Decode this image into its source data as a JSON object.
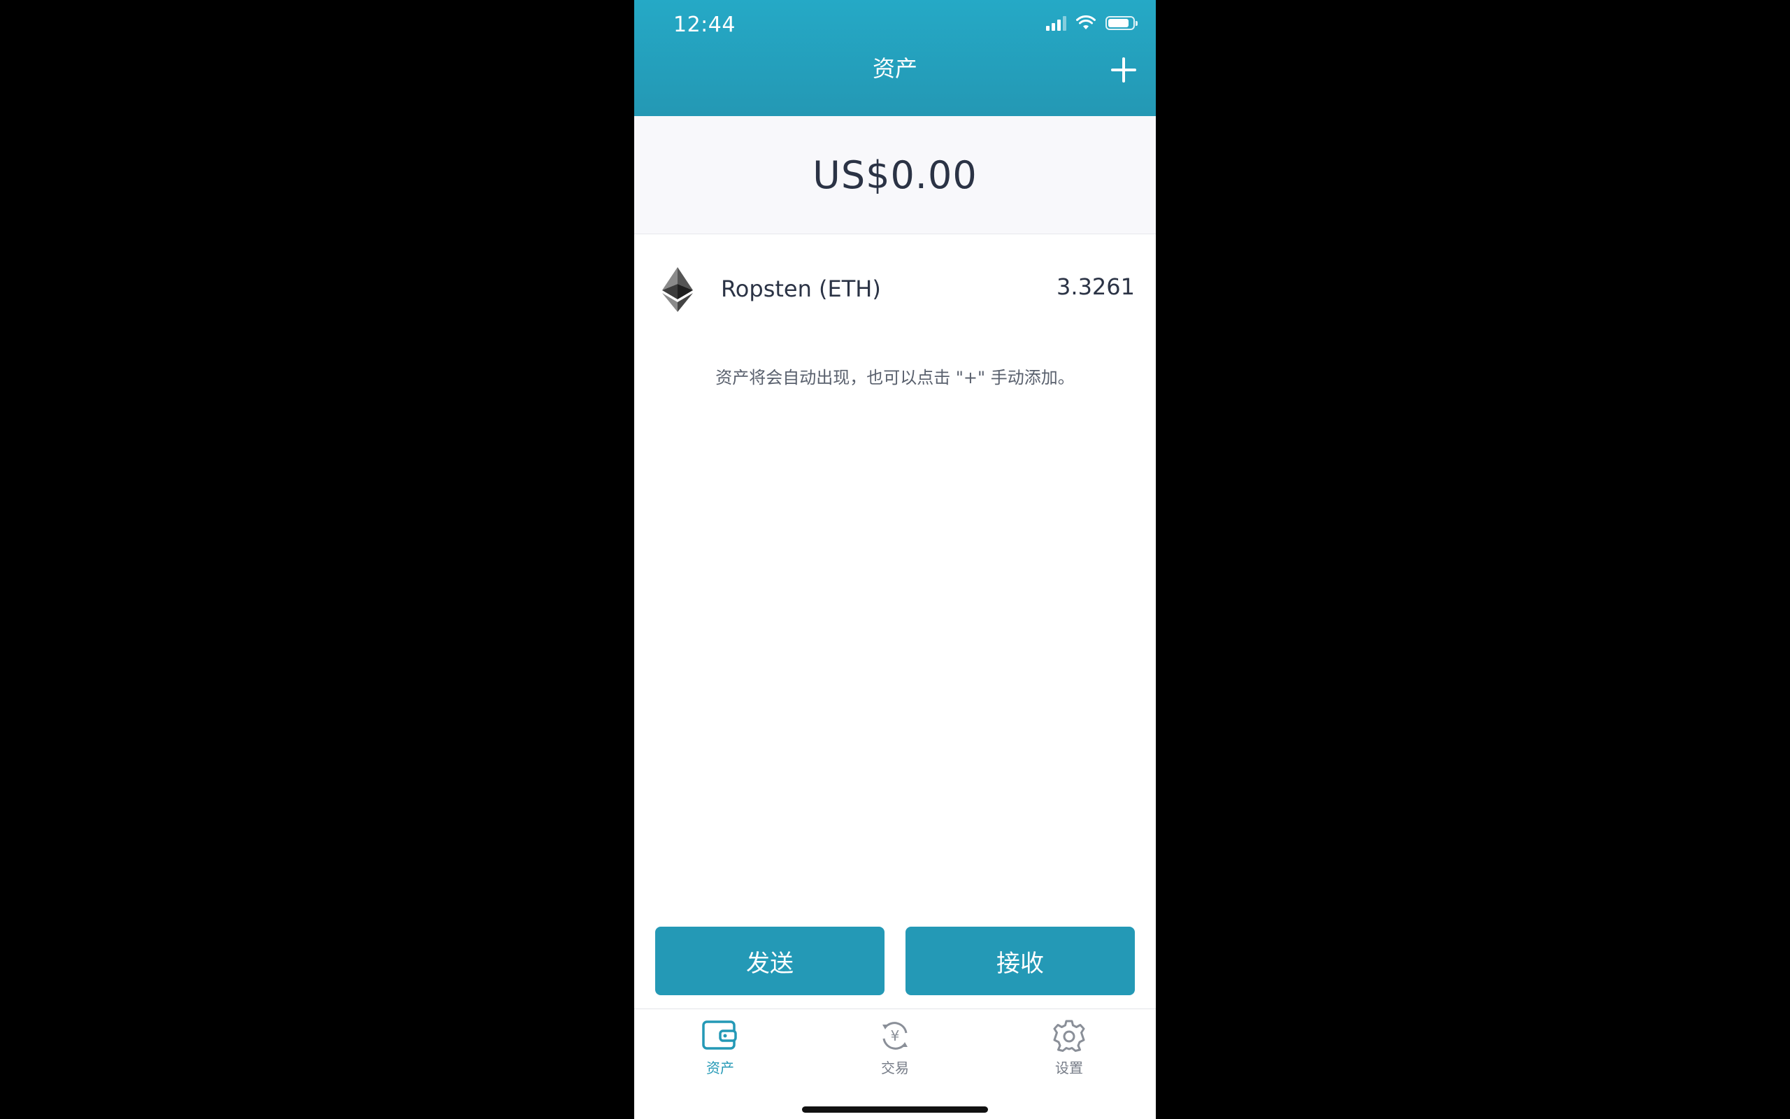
{
  "status_bar": {
    "time": "12:44",
    "signal_icon": "signal-icon",
    "wifi_icon": "wifi-icon",
    "battery_icon": "battery-icon",
    "battery_level": 0.85
  },
  "header": {
    "title": "资产",
    "add_icon": "plus-icon",
    "background_color": "#25a9c6"
  },
  "balance": {
    "total": "US$0.00"
  },
  "assets": [
    {
      "icon": "ethereum-icon",
      "name": "Ropsten (ETH)",
      "amount": "3.3261"
    }
  ],
  "hint_text": "资产将会自动出现，也可以点击 \"+\" 手动添加。",
  "actions": {
    "send_label": "发送",
    "receive_label": "接收",
    "button_color": "#2499b6"
  },
  "tab_bar": {
    "tabs": [
      {
        "label": "资产",
        "icon": "wallet-icon",
        "active": true
      },
      {
        "label": "交易",
        "icon": "exchange-icon",
        "active": false
      },
      {
        "label": "设置",
        "icon": "gear-icon",
        "active": false
      }
    ],
    "active_color": "#2499b6",
    "inactive_color": "#777d88"
  }
}
